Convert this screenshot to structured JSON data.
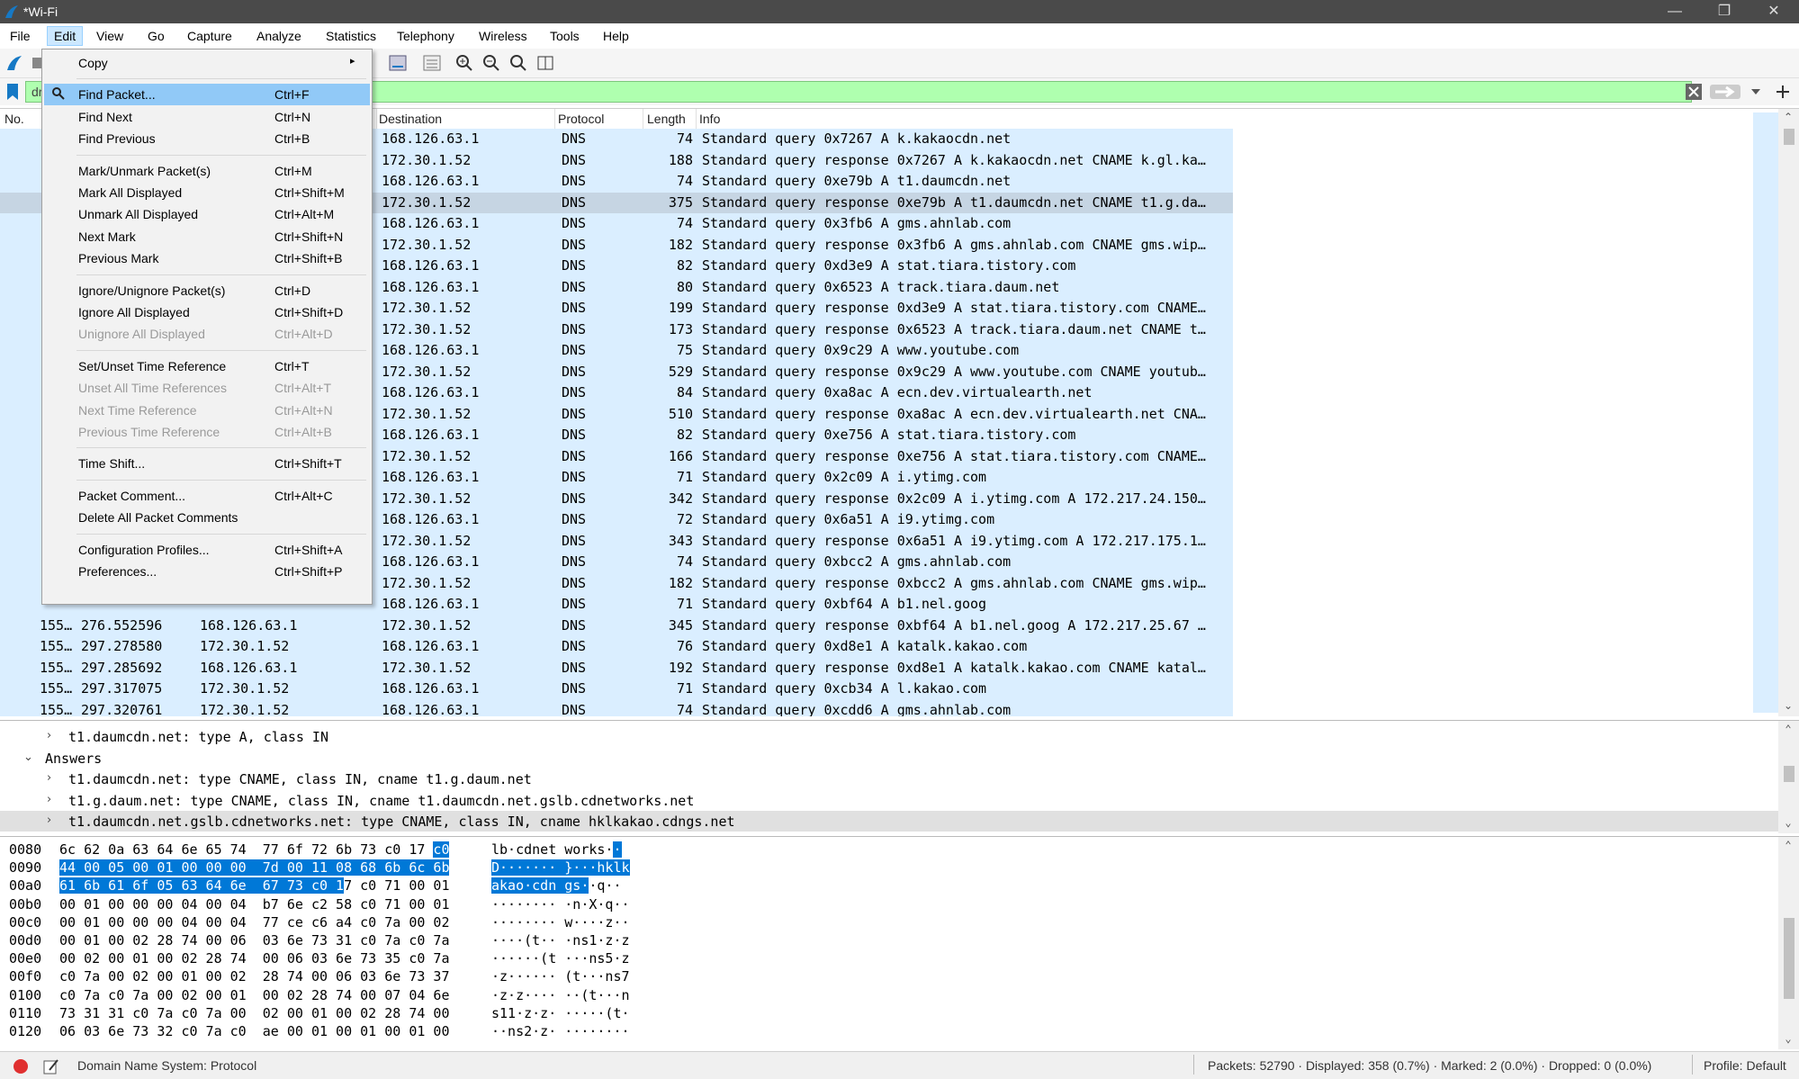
{
  "window": {
    "title": "*Wi-Fi",
    "minimize": "—",
    "maximize": "❐",
    "close": "✕"
  },
  "menubar": [
    "File",
    "Edit",
    "View",
    "Go",
    "Capture",
    "Analyze",
    "Statistics",
    "Telephony",
    "Wireless",
    "Tools",
    "Help"
  ],
  "filter": {
    "text": "dr",
    "accent_color": "#afffaf"
  },
  "packet_list": {
    "columns": [
      "No.",
      "Destination",
      "Protocol",
      "Length",
      "Info"
    ],
    "rows": [
      {
        "no": "",
        "time": "",
        "src": "",
        "dst": "168.126.63.1",
        "proto": "DNS",
        "len": "74",
        "info": "Standard query 0x7267 A k.kakaocdn.net"
      },
      {
        "no": "",
        "time": "",
        "src": "",
        "dst": "172.30.1.52",
        "proto": "DNS",
        "len": "188",
        "info": "Standard query response 0x7267 A k.kakaocdn.net CNAME k.gl.ka…"
      },
      {
        "no": "",
        "time": "",
        "src": "",
        "dst": "168.126.63.1",
        "proto": "DNS",
        "len": "74",
        "info": "Standard query 0xe79b A t1.daumcdn.net"
      },
      {
        "no": "",
        "time": "",
        "src": "",
        "dst": "172.30.1.52",
        "proto": "DNS",
        "len": "375",
        "info": "Standard query response 0xe79b A t1.daumcdn.net CNAME t1.g.da…"
      },
      {
        "no": "",
        "time": "",
        "src": "",
        "dst": "168.126.63.1",
        "proto": "DNS",
        "len": "74",
        "info": "Standard query 0x3fb6 A gms.ahnlab.com"
      },
      {
        "no": "",
        "time": "",
        "src": "",
        "dst": "172.30.1.52",
        "proto": "DNS",
        "len": "182",
        "info": "Standard query response 0x3fb6 A gms.ahnlab.com CNAME gms.wip…"
      },
      {
        "no": "",
        "time": "",
        "src": "",
        "dst": "168.126.63.1",
        "proto": "DNS",
        "len": "82",
        "info": "Standard query 0xd3e9 A stat.tiara.tistory.com"
      },
      {
        "no": "",
        "time": "",
        "src": "",
        "dst": "168.126.63.1",
        "proto": "DNS",
        "len": "80",
        "info": "Standard query 0x6523 A track.tiara.daum.net"
      },
      {
        "no": "",
        "time": "",
        "src": "",
        "dst": "172.30.1.52",
        "proto": "DNS",
        "len": "199",
        "info": "Standard query response 0xd3e9 A stat.tiara.tistory.com CNAME…"
      },
      {
        "no": "",
        "time": "",
        "src": "",
        "dst": "172.30.1.52",
        "proto": "DNS",
        "len": "173",
        "info": "Standard query response 0x6523 A track.tiara.daum.net CNAME t…"
      },
      {
        "no": "",
        "time": "",
        "src": "",
        "dst": "168.126.63.1",
        "proto": "DNS",
        "len": "75",
        "info": "Standard query 0x9c29 A www.youtube.com"
      },
      {
        "no": "",
        "time": "",
        "src": "",
        "dst": "172.30.1.52",
        "proto": "DNS",
        "len": "529",
        "info": "Standard query response 0x9c29 A www.youtube.com CNAME youtub…"
      },
      {
        "no": "",
        "time": "",
        "src": "",
        "dst": "168.126.63.1",
        "proto": "DNS",
        "len": "84",
        "info": "Standard query 0xa8ac A ecn.dev.virtualearth.net"
      },
      {
        "no": "",
        "time": "",
        "src": "",
        "dst": "172.30.1.52",
        "proto": "DNS",
        "len": "510",
        "info": "Standard query response 0xa8ac A ecn.dev.virtualearth.net CNA…"
      },
      {
        "no": "",
        "time": "",
        "src": "",
        "dst": "168.126.63.1",
        "proto": "DNS",
        "len": "82",
        "info": "Standard query 0xe756 A stat.tiara.tistory.com"
      },
      {
        "no": "",
        "time": "",
        "src": "",
        "dst": "172.30.1.52",
        "proto": "DNS",
        "len": "166",
        "info": "Standard query response 0xe756 A stat.tiara.tistory.com CNAME…"
      },
      {
        "no": "",
        "time": "",
        "src": "",
        "dst": "168.126.63.1",
        "proto": "DNS",
        "len": "71",
        "info": "Standard query 0x2c09 A i.ytimg.com"
      },
      {
        "no": "",
        "time": "",
        "src": "",
        "dst": "172.30.1.52",
        "proto": "DNS",
        "len": "342",
        "info": "Standard query response 0x2c09 A i.ytimg.com A 172.217.24.150…"
      },
      {
        "no": "",
        "time": "",
        "src": "",
        "dst": "168.126.63.1",
        "proto": "DNS",
        "len": "72",
        "info": "Standard query 0x6a51 A i9.ytimg.com"
      },
      {
        "no": "",
        "time": "",
        "src": "",
        "dst": "172.30.1.52",
        "proto": "DNS",
        "len": "343",
        "info": "Standard query response 0x6a51 A i9.ytimg.com A 172.217.175.1…"
      },
      {
        "no": "",
        "time": "",
        "src": "",
        "dst": "168.126.63.1",
        "proto": "DNS",
        "len": "74",
        "info": "Standard query 0xbcc2 A gms.ahnlab.com"
      },
      {
        "no": "",
        "time": "",
        "src": "",
        "dst": "172.30.1.52",
        "proto": "DNS",
        "len": "182",
        "info": "Standard query response 0xbcc2 A gms.ahnlab.com CNAME gms.wip…"
      },
      {
        "no": "",
        "time": "",
        "src": "",
        "dst": "168.126.63.1",
        "proto": "DNS",
        "len": "71",
        "info": "Standard query 0xbf64 A b1.nel.goog"
      },
      {
        "no": "155…",
        "time": "276.552596",
        "src": "168.126.63.1",
        "dst": "172.30.1.52",
        "proto": "DNS",
        "len": "345",
        "info": "Standard query response 0xbf64 A b1.nel.goog A 172.217.25.67 …"
      },
      {
        "no": "155…",
        "time": "297.278580",
        "src": "172.30.1.52",
        "dst": "168.126.63.1",
        "proto": "DNS",
        "len": "76",
        "info": "Standard query 0xd8e1 A katalk.kakao.com"
      },
      {
        "no": "155…",
        "time": "297.285692",
        "src": "168.126.63.1",
        "dst": "172.30.1.52",
        "proto": "DNS",
        "len": "192",
        "info": "Standard query response 0xd8e1 A katalk.kakao.com CNAME katal…"
      },
      {
        "no": "155…",
        "time": "297.317075",
        "src": "172.30.1.52",
        "dst": "168.126.63.1",
        "proto": "DNS",
        "len": "71",
        "info": "Standard query 0xcb34 A l.kakao.com"
      },
      {
        "no": "155…",
        "time": "297.320761",
        "src": "172.30.1.52",
        "dst": "168.126.63.1",
        "proto": "DNS",
        "len": "74",
        "info": "Standard query 0xcdd6 A gms.ahnlab.com"
      }
    ]
  },
  "details": [
    {
      "arrow": "›",
      "text": "t1.daumcdn.net: type A, class IN"
    },
    {
      "arrow": "⌄",
      "text": "Answers"
    },
    {
      "arrow": "›",
      "text": "t1.daumcdn.net: type CNAME, class IN, cname t1.g.daum.net"
    },
    {
      "arrow": "›",
      "text": "t1.g.daum.net: type CNAME, class IN, cname t1.daumcdn.net.gslb.cdnetworks.net"
    },
    {
      "arrow": "›",
      "text": "t1.daumcdn.net.gslb.cdnetworks.net: type CNAME, class IN, cname hklkakao.cdngs.net"
    }
  ],
  "bytes": [
    {
      "off": "0080",
      "hex": "6c 62 0a 63 64 6e 65 74  77 6f 72 6b 73 c0 17 c0",
      "ascii": "lb·cdnet works··"
    },
    {
      "off": "0090",
      "hex": "44 00 05 00 01 00 00 00  7d 00 11 08 68 6b 6c 6b",
      "ascii": "D······· }···hklk"
    },
    {
      "off": "00a0",
      "hex": "61 6b 61 6f 05 63 64 6e  67 73 c0 17 c0 71 00 01",
      "ascii": "akao·cdn gs··q··"
    },
    {
      "off": "00b0",
      "hex": "00 01 00 00 00 04 00 04  b7 6e c2 58 c0 71 00 01",
      "ascii": "········ ·n·X·q··"
    },
    {
      "off": "00c0",
      "hex": "00 01 00 00 00 04 00 04  77 ce c6 a4 c0 7a 00 02",
      "ascii": "········ w····z··"
    },
    {
      "off": "00d0",
      "hex": "00 01 00 02 28 74 00 06  03 6e 73 31 c0 7a c0 7a",
      "ascii": "····(t·· ·ns1·z·z"
    },
    {
      "off": "00e0",
      "hex": "00 02 00 01 00 02 28 74  00 06 03 6e 73 35 c0 7a",
      "ascii": "······(t ···ns5·z"
    },
    {
      "off": "00f0",
      "hex": "c0 7a 00 02 00 01 00 02  28 74 00 06 03 6e 73 37",
      "ascii": "·z······ (t···ns7"
    },
    {
      "off": "0100",
      "hex": "c0 7a c0 7a 00 02 00 01  00 02 28 74 00 07 04 6e",
      "ascii": "·z·z···· ··(t···n"
    },
    {
      "off": "0110",
      "hex": "73 31 31 c0 7a c0 7a 00  02 00 01 00 02 28 74 00",
      "ascii": "s11·z·z· ·····(t·"
    },
    {
      "off": "0120",
      "hex": "06 03 6e 73 32 c0 7a c0  ae 00 01 00 01 00 01 00",
      "ascii": "··ns2·z· ········"
    }
  ],
  "status": {
    "protocol": "Domain Name System: Protocol",
    "packets": "Packets: 52790 · Displayed: 358 (0.7%) · Marked: 2 (0.0%) · Dropped: 0 (0.0%)",
    "profile": "Profile: Default"
  },
  "edit_menu": [
    {
      "label": "Copy",
      "shortcut": "",
      "submenu": true
    },
    {
      "sep": true
    },
    {
      "label": "Find Packet...",
      "shortcut": "Ctrl+F",
      "hover": true,
      "icon": "search-icon"
    },
    {
      "label": "Find Next",
      "shortcut": "Ctrl+N"
    },
    {
      "label": "Find Previous",
      "shortcut": "Ctrl+B"
    },
    {
      "sep": true
    },
    {
      "label": "Mark/Unmark Packet(s)",
      "shortcut": "Ctrl+M"
    },
    {
      "label": "Mark All Displayed",
      "shortcut": "Ctrl+Shift+M"
    },
    {
      "label": "Unmark All Displayed",
      "shortcut": "Ctrl+Alt+M"
    },
    {
      "label": "Next Mark",
      "shortcut": "Ctrl+Shift+N"
    },
    {
      "label": "Previous Mark",
      "shortcut": "Ctrl+Shift+B"
    },
    {
      "sep": true
    },
    {
      "label": "Ignore/Unignore Packet(s)",
      "shortcut": "Ctrl+D"
    },
    {
      "label": "Ignore All Displayed",
      "shortcut": "Ctrl+Shift+D"
    },
    {
      "label": "Unignore All Displayed",
      "shortcut": "Ctrl+Alt+D",
      "disabled": true
    },
    {
      "sep": true
    },
    {
      "label": "Set/Unset Time Reference",
      "shortcut": "Ctrl+T"
    },
    {
      "label": "Unset All Time References",
      "shortcut": "Ctrl+Alt+T",
      "disabled": true
    },
    {
      "label": "Next Time Reference",
      "shortcut": "Ctrl+Alt+N",
      "disabled": true
    },
    {
      "label": "Previous Time Reference",
      "shortcut": "Ctrl+Alt+B",
      "disabled": true
    },
    {
      "sep": true
    },
    {
      "label": "Time Shift...",
      "shortcut": "Ctrl+Shift+T"
    },
    {
      "sep": true
    },
    {
      "label": "Packet Comment...",
      "shortcut": "Ctrl+Alt+C"
    },
    {
      "label": "Delete All Packet Comments",
      "shortcut": ""
    },
    {
      "sep": true
    },
    {
      "label": "Configuration Profiles...",
      "shortcut": "Ctrl+Shift+A"
    },
    {
      "label": "Preferences...",
      "shortcut": "Ctrl+Shift+P"
    }
  ],
  "colors": {
    "row_bg": "#daeeff",
    "row_selected": "#c6d5e3",
    "byte_highlight": "#0078d7",
    "menu_hover": "#91c9f7",
    "filter_ok": "#afffaf"
  }
}
